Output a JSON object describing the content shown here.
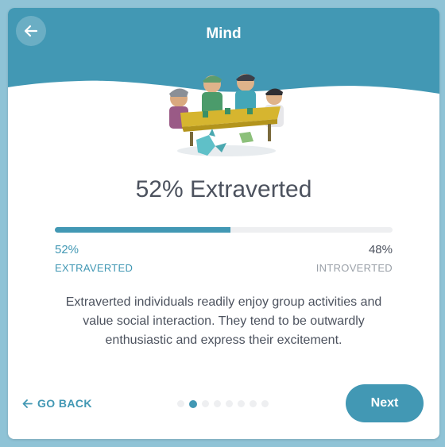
{
  "header": {
    "title": "Mind",
    "back_icon": "arrow-left-icon",
    "accent_color": "#4298b4"
  },
  "illustration": {
    "icon": "group-at-table-illustration"
  },
  "result": {
    "headline": "52% Extraverted",
    "progress_fraction": 0.52,
    "left_percent": "52%",
    "left_label": "EXTRAVERTED",
    "right_percent": "48%",
    "right_label": "INTROVERTED"
  },
  "description": "Extraverted individuals readily enjoy group activities and value social interaction. They tend to be outwardly enthusiastic and express their excitement.",
  "footer": {
    "go_back_label": "GO BACK",
    "go_back_icon": "arrow-left-icon",
    "next_label": "Next",
    "page_count": 8,
    "current_page": 2
  }
}
